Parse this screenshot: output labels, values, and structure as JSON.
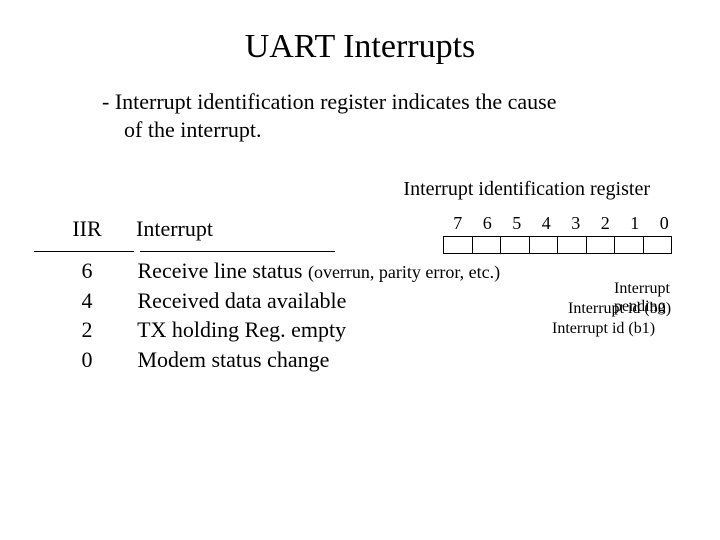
{
  "title": "UART Interrupts",
  "desc_line1": "- Interrupt identification register indicates the cause",
  "desc_line2": "of the interrupt.",
  "caption": "Interrupt identification register",
  "table": {
    "head_code": "IIR",
    "head_name": "Interrupt",
    "rows": [
      {
        "code": "6",
        "name": "Receive line status ",
        "note": "(overrun, parity error, etc.)"
      },
      {
        "code": "4",
        "name": "Received data available",
        "note": ""
      },
      {
        "code": "2",
        "name": "TX holding Reg. empty",
        "note": ""
      },
      {
        "code": "0",
        "name": "Modem status change",
        "note": ""
      }
    ]
  },
  "bits": [
    "7",
    "6",
    "5",
    "4",
    "3",
    "2",
    "1",
    "0"
  ],
  "annotations": {
    "pending": "Interrupt pending",
    "b0": "Interrupt id (b0)",
    "b1": "Interrupt id (b1)"
  }
}
